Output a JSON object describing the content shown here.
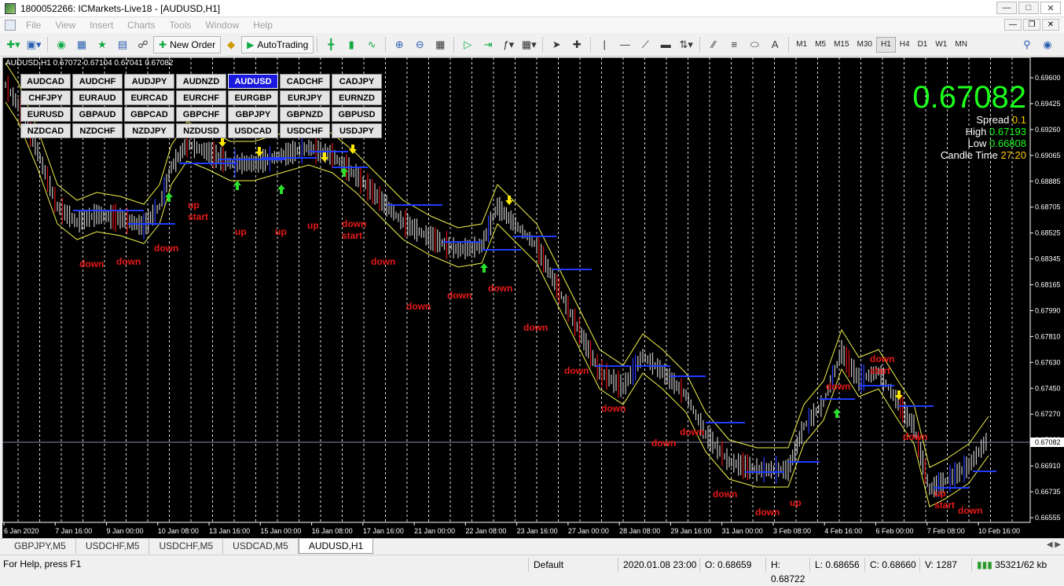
{
  "window": {
    "title": "1800052266: ICMarkets-Live18 - [AUDUSD,H1]"
  },
  "menu": [
    "File",
    "View",
    "Insert",
    "Charts",
    "Tools",
    "Window",
    "Help"
  ],
  "toolbar": {
    "new_order": "New Order",
    "autotrading": "AutoTrading",
    "timeframes": [
      "M1",
      "M5",
      "M15",
      "M30",
      "H1",
      "H4",
      "D1",
      "W1",
      "MN"
    ],
    "active_timeframe": "H1"
  },
  "chart": {
    "header": "AUDUSD,H1  0.67072 0.67104 0.67041 0.67082",
    "symbols": [
      "AUDCAD",
      "AUDCHF",
      "AUDJPY",
      "AUDNZD",
      "AUDUSD",
      "CADCHF",
      "CADJPY",
      "CHFJPY",
      "EURAUD",
      "EURCAD",
      "EURCHF",
      "EURGBP",
      "EURJPY",
      "EURNZD",
      "EURUSD",
      "GBPAUD",
      "GBPCAD",
      "GBPCHF",
      "GBPJPY",
      "GBPNZD",
      "GBPUSD",
      "NZDCAD",
      "NZDCHF",
      "NZDJPY",
      "NZDUSD",
      "USDCAD",
      "USDCHF",
      "USDJPY"
    ],
    "active_symbol": "AUDUSD",
    "price": "0.67082",
    "spread_label": "Spread",
    "spread": "0.1",
    "high_label": "High",
    "high": "0.67193",
    "low_label": "Low",
    "low": "0.66808",
    "candle_label": "Candle Time",
    "candle_time": "27:20",
    "price_axis": [
      "0.69600",
      "0.69425",
      "0.69260",
      "0.69065",
      "0.68885",
      "0.68705",
      "0.68525",
      "0.68345",
      "0.68165",
      "0.67990",
      "0.67810",
      "0.67630",
      "0.67450",
      "0.67270",
      "0.67082",
      "0.66910",
      "0.66735",
      "0.66555"
    ],
    "time_axis": [
      "6 Jan 2020",
      "7 Jan 16:00",
      "9 Jan 00:00",
      "10 Jan 08:00",
      "13 Jan 16:00",
      "15 Jan 00:00",
      "16 Jan 08:00",
      "17 Jan 16:00",
      "21 Jan 00:00",
      "22 Jan 08:00",
      "23 Jan 16:00",
      "27 Jan 00:00",
      "28 Jan 08:00",
      "29 Jan 16:00",
      "31 Jan 00:00",
      "3 Feb 08:00",
      "4 Feb 16:00",
      "6 Feb 00:00",
      "7 Feb 08:00",
      "10 Feb 16:00"
    ],
    "labels": [
      "up start",
      "up",
      "up",
      "up",
      "down start",
      "down",
      "down",
      "down",
      "down",
      "down",
      "down",
      "down",
      "down",
      "down",
      "down",
      "down",
      "down",
      "down",
      "down",
      "up",
      "up start",
      "down start",
      "down",
      "down",
      "down"
    ]
  },
  "tabs": [
    "GBPJPY,M5",
    "USDCHF,M5",
    "USDCHF,M5",
    "USDCAD,M5",
    "AUDUSD,H1"
  ],
  "active_tab": "AUDUSD,H1",
  "status": {
    "help": "For Help, press F1",
    "profile": "Default",
    "datetime": "2020.01.08 23:00",
    "open": "O: 0.68659",
    "high": "H: 0.68722",
    "low": "L: 0.68656",
    "close": "C: 0.68660",
    "volume": "V: 1287",
    "traffic": "35321/62 kb"
  }
}
